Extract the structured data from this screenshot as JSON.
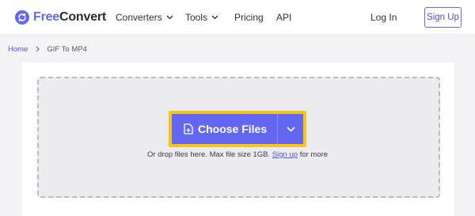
{
  "brand": {
    "part1": "Free",
    "part2": "Convert",
    "accent": "#6366f1"
  },
  "nav": {
    "converters": "Converters",
    "tools": "Tools",
    "pricing": "Pricing",
    "api": "API",
    "login": "Log In",
    "signup": "Sign Up"
  },
  "breadcrumb": {
    "home": "Home",
    "current": "GIF To MP4"
  },
  "upload": {
    "button_label": "Choose Files",
    "hint_before": "Or drop files here. Max file size 1GB.",
    "hint_link": "Sign up",
    "hint_after": "for more",
    "highlight_color": "#f5c518"
  },
  "icons": [
    "logo-icon",
    "chevron-down-icon",
    "chevron-right-icon",
    "file-plus-icon"
  ]
}
